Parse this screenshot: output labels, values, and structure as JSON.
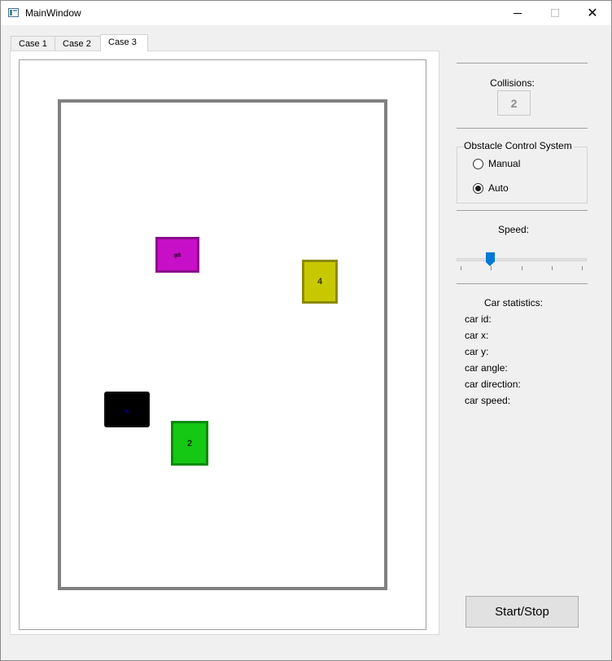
{
  "window": {
    "title": "MainWindow",
    "minimize_icon": "minimize-icon",
    "maximize_icon": "maximize-icon",
    "close_icon": "close-icon"
  },
  "tabs": [
    {
      "label": "Case 1",
      "selected": false
    },
    {
      "label": "Case 2",
      "selected": false
    },
    {
      "label": "Case 3",
      "selected": true
    }
  ],
  "arena": {
    "cars": [
      {
        "label": "⇌",
        "color": "#c80fc8"
      },
      {
        "label": "4",
        "color": "#c8c800"
      },
      {
        "label": "⁎",
        "color": "#000000"
      },
      {
        "label": "2",
        "color": "#14c814"
      }
    ]
  },
  "collisions": {
    "label": "Collisions:",
    "value": "2"
  },
  "obstacle_control": {
    "title": "Obstacle Control System",
    "options": [
      {
        "label": "Manual",
        "checked": false
      },
      {
        "label": "Auto",
        "checked": true
      }
    ]
  },
  "speed": {
    "label": "Speed:",
    "value": 0.25
  },
  "car_statistics": {
    "title": "Car statistics:",
    "fields": [
      "car id:",
      "car x:",
      "car y:",
      "car angle:",
      "car direction:",
      "car speed:"
    ]
  },
  "start_stop_label": "Start/Stop",
  "colors": {
    "accent": "#0078d7",
    "window_bg": "#f0f0f0",
    "arena_border": "#808080"
  }
}
